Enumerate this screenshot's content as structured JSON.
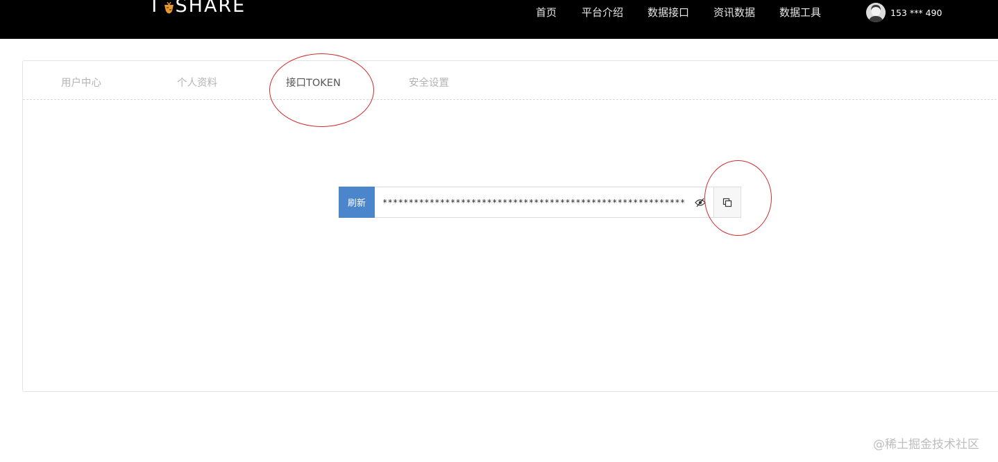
{
  "header": {
    "logo_text_left": "T",
    "logo_text_right": "SHARE",
    "nav": [
      {
        "label": "首页"
      },
      {
        "label": "平台介绍"
      },
      {
        "label": "数据接口"
      },
      {
        "label": "资讯数据"
      },
      {
        "label": "数据工具"
      }
    ],
    "user": {
      "phone": "153 *** 490"
    }
  },
  "tabs": [
    {
      "label": "用户中心",
      "active": false
    },
    {
      "label": "个人资料",
      "active": false
    },
    {
      "label": "接口TOKEN",
      "active": true
    },
    {
      "label": "安全设置",
      "active": false
    }
  ],
  "token": {
    "refresh_label": "刷新",
    "masked_value": "****************************************************************"
  },
  "colors": {
    "navbar_bg": "#000000",
    "refresh_button": "#4b86cc",
    "annotation": "#d32a2a",
    "logo_accent": "#e8962e"
  },
  "icons": {
    "eye": "eye-slash-icon",
    "copy": "copy-icon",
    "avatar": "user-avatar-icon"
  },
  "watermark": "@稀土掘金技术社区"
}
